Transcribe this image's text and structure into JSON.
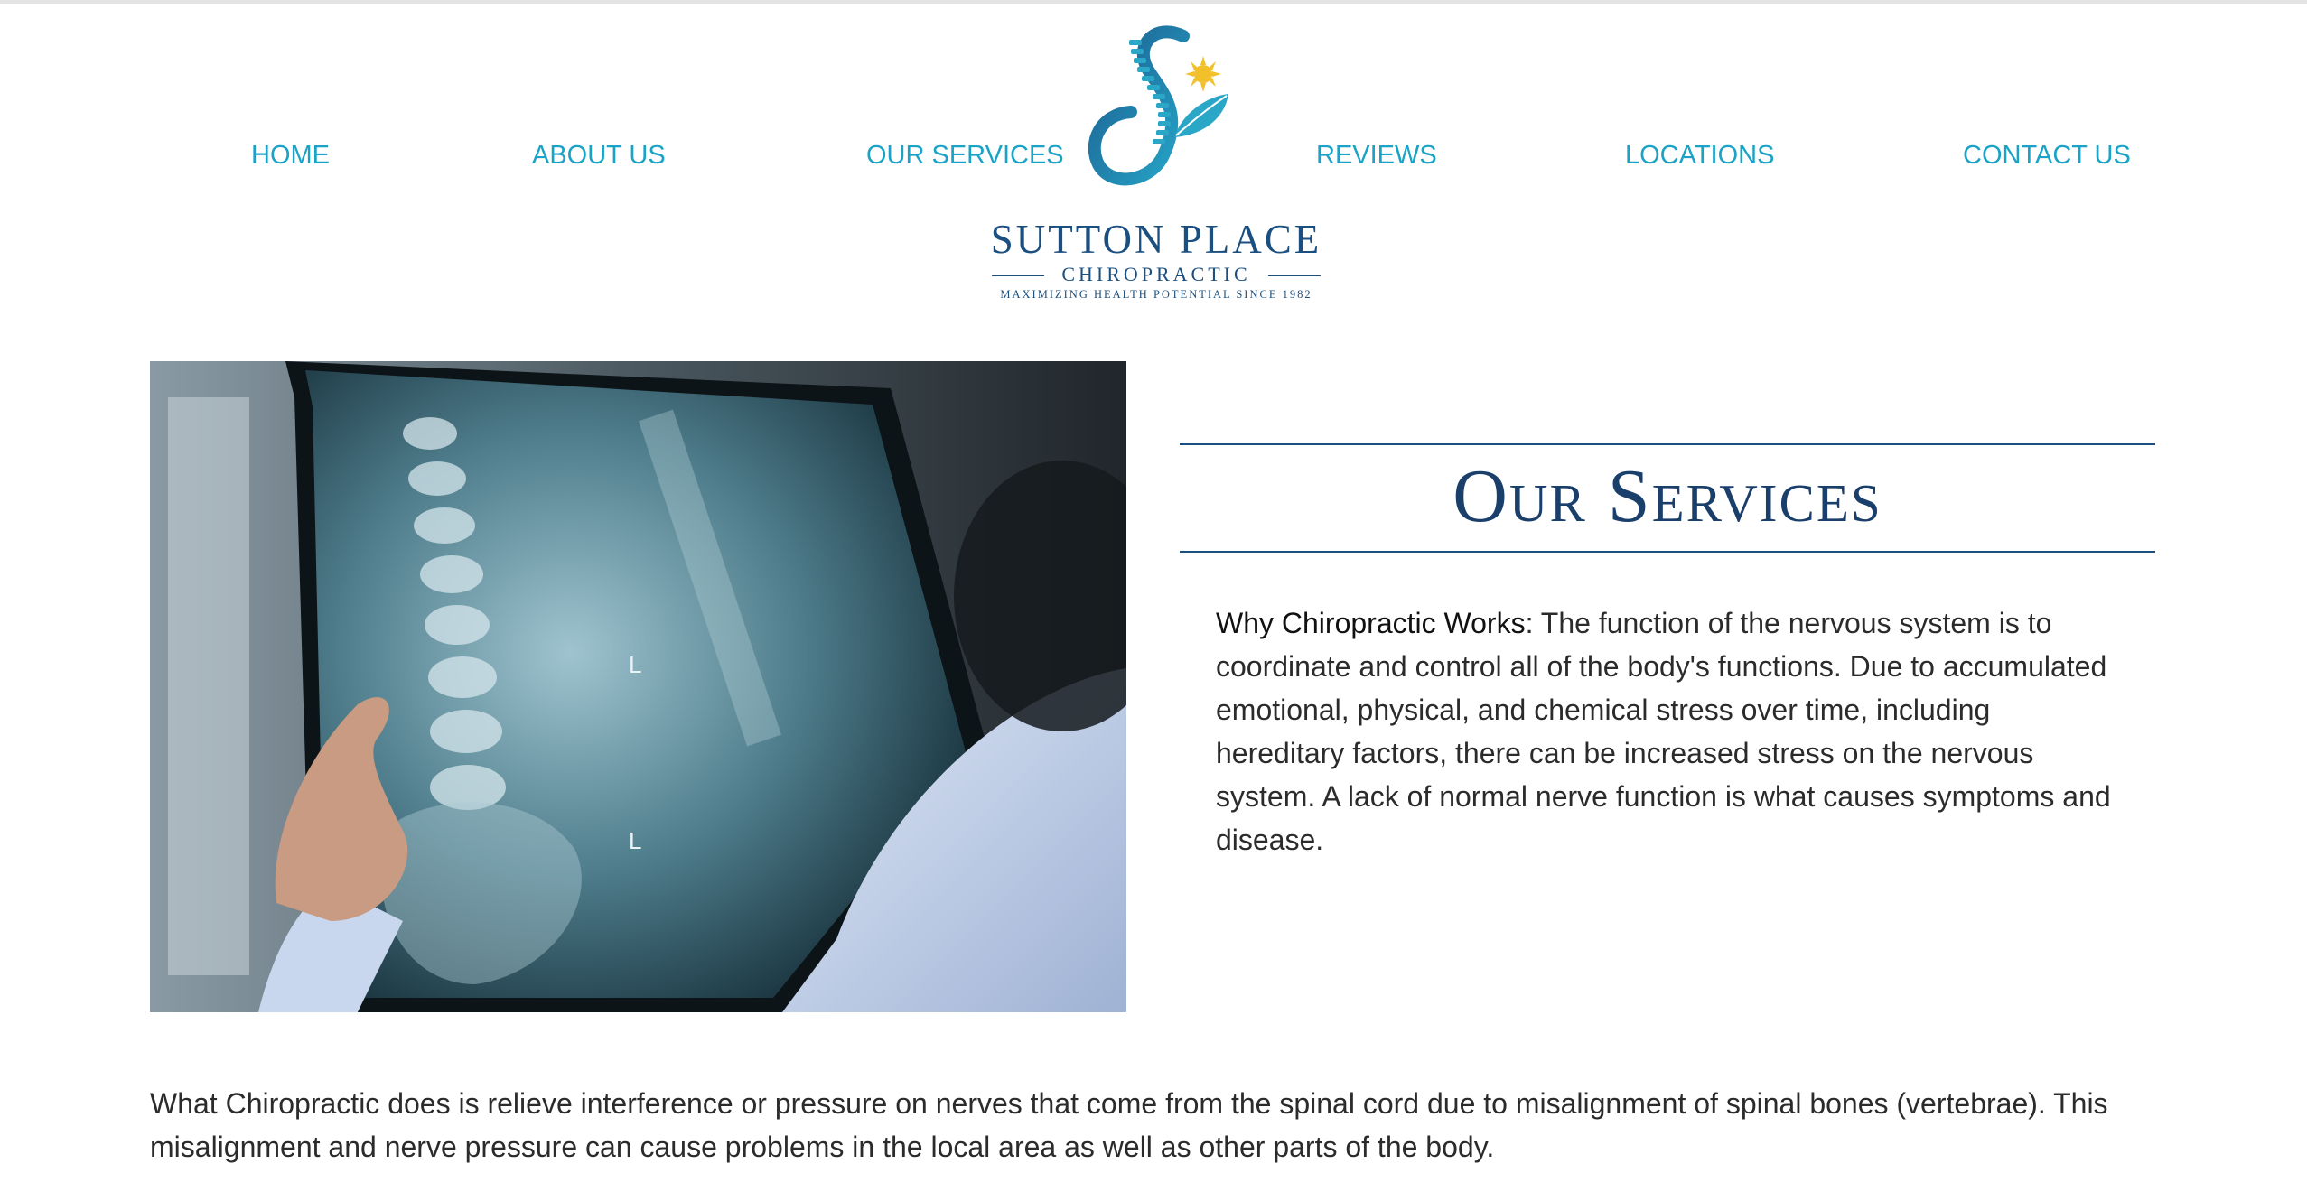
{
  "nav": {
    "home": "HOME",
    "about": "ABOUT US",
    "services": "OUR SERVICES",
    "reviews": "REVIEWS",
    "locations": "LOCATIONS",
    "contact": "CONTACT US"
  },
  "logo": {
    "name": "SUTTON PLACE",
    "subtitle": "CHIROPRACTIC",
    "tagline": "MAXIMIZING HEALTH POTENTIAL SINCE 1982",
    "icon": "spine-leaf-sun-logo-icon"
  },
  "hero": {
    "image": "doctor-holding-spine-xray-image"
  },
  "section": {
    "title": "Our Services",
    "intro_lead": "Why Chiropractic Works",
    "intro_text": ": The function of the nervous system is to coordinate and control all of the body's functions. Due to accumulated emotional, physical, and chemical stress over time, including hereditary factors, there can be increased stress on the nervous system. A lack of normal nerve function is what causes symptoms and disease.",
    "body": "What Chiropractic does is relieve interference or pressure on nerves that come from the spinal cord due to misalignment of spinal bones (vertebrae). This misalignment and nerve pressure can cause problems in the local area as well as other parts of the body."
  },
  "colors": {
    "nav": "#1aa3c6",
    "brand_navy": "#1b4f7f",
    "heading": "#1b3f6b",
    "text": "#2b2b2b"
  }
}
